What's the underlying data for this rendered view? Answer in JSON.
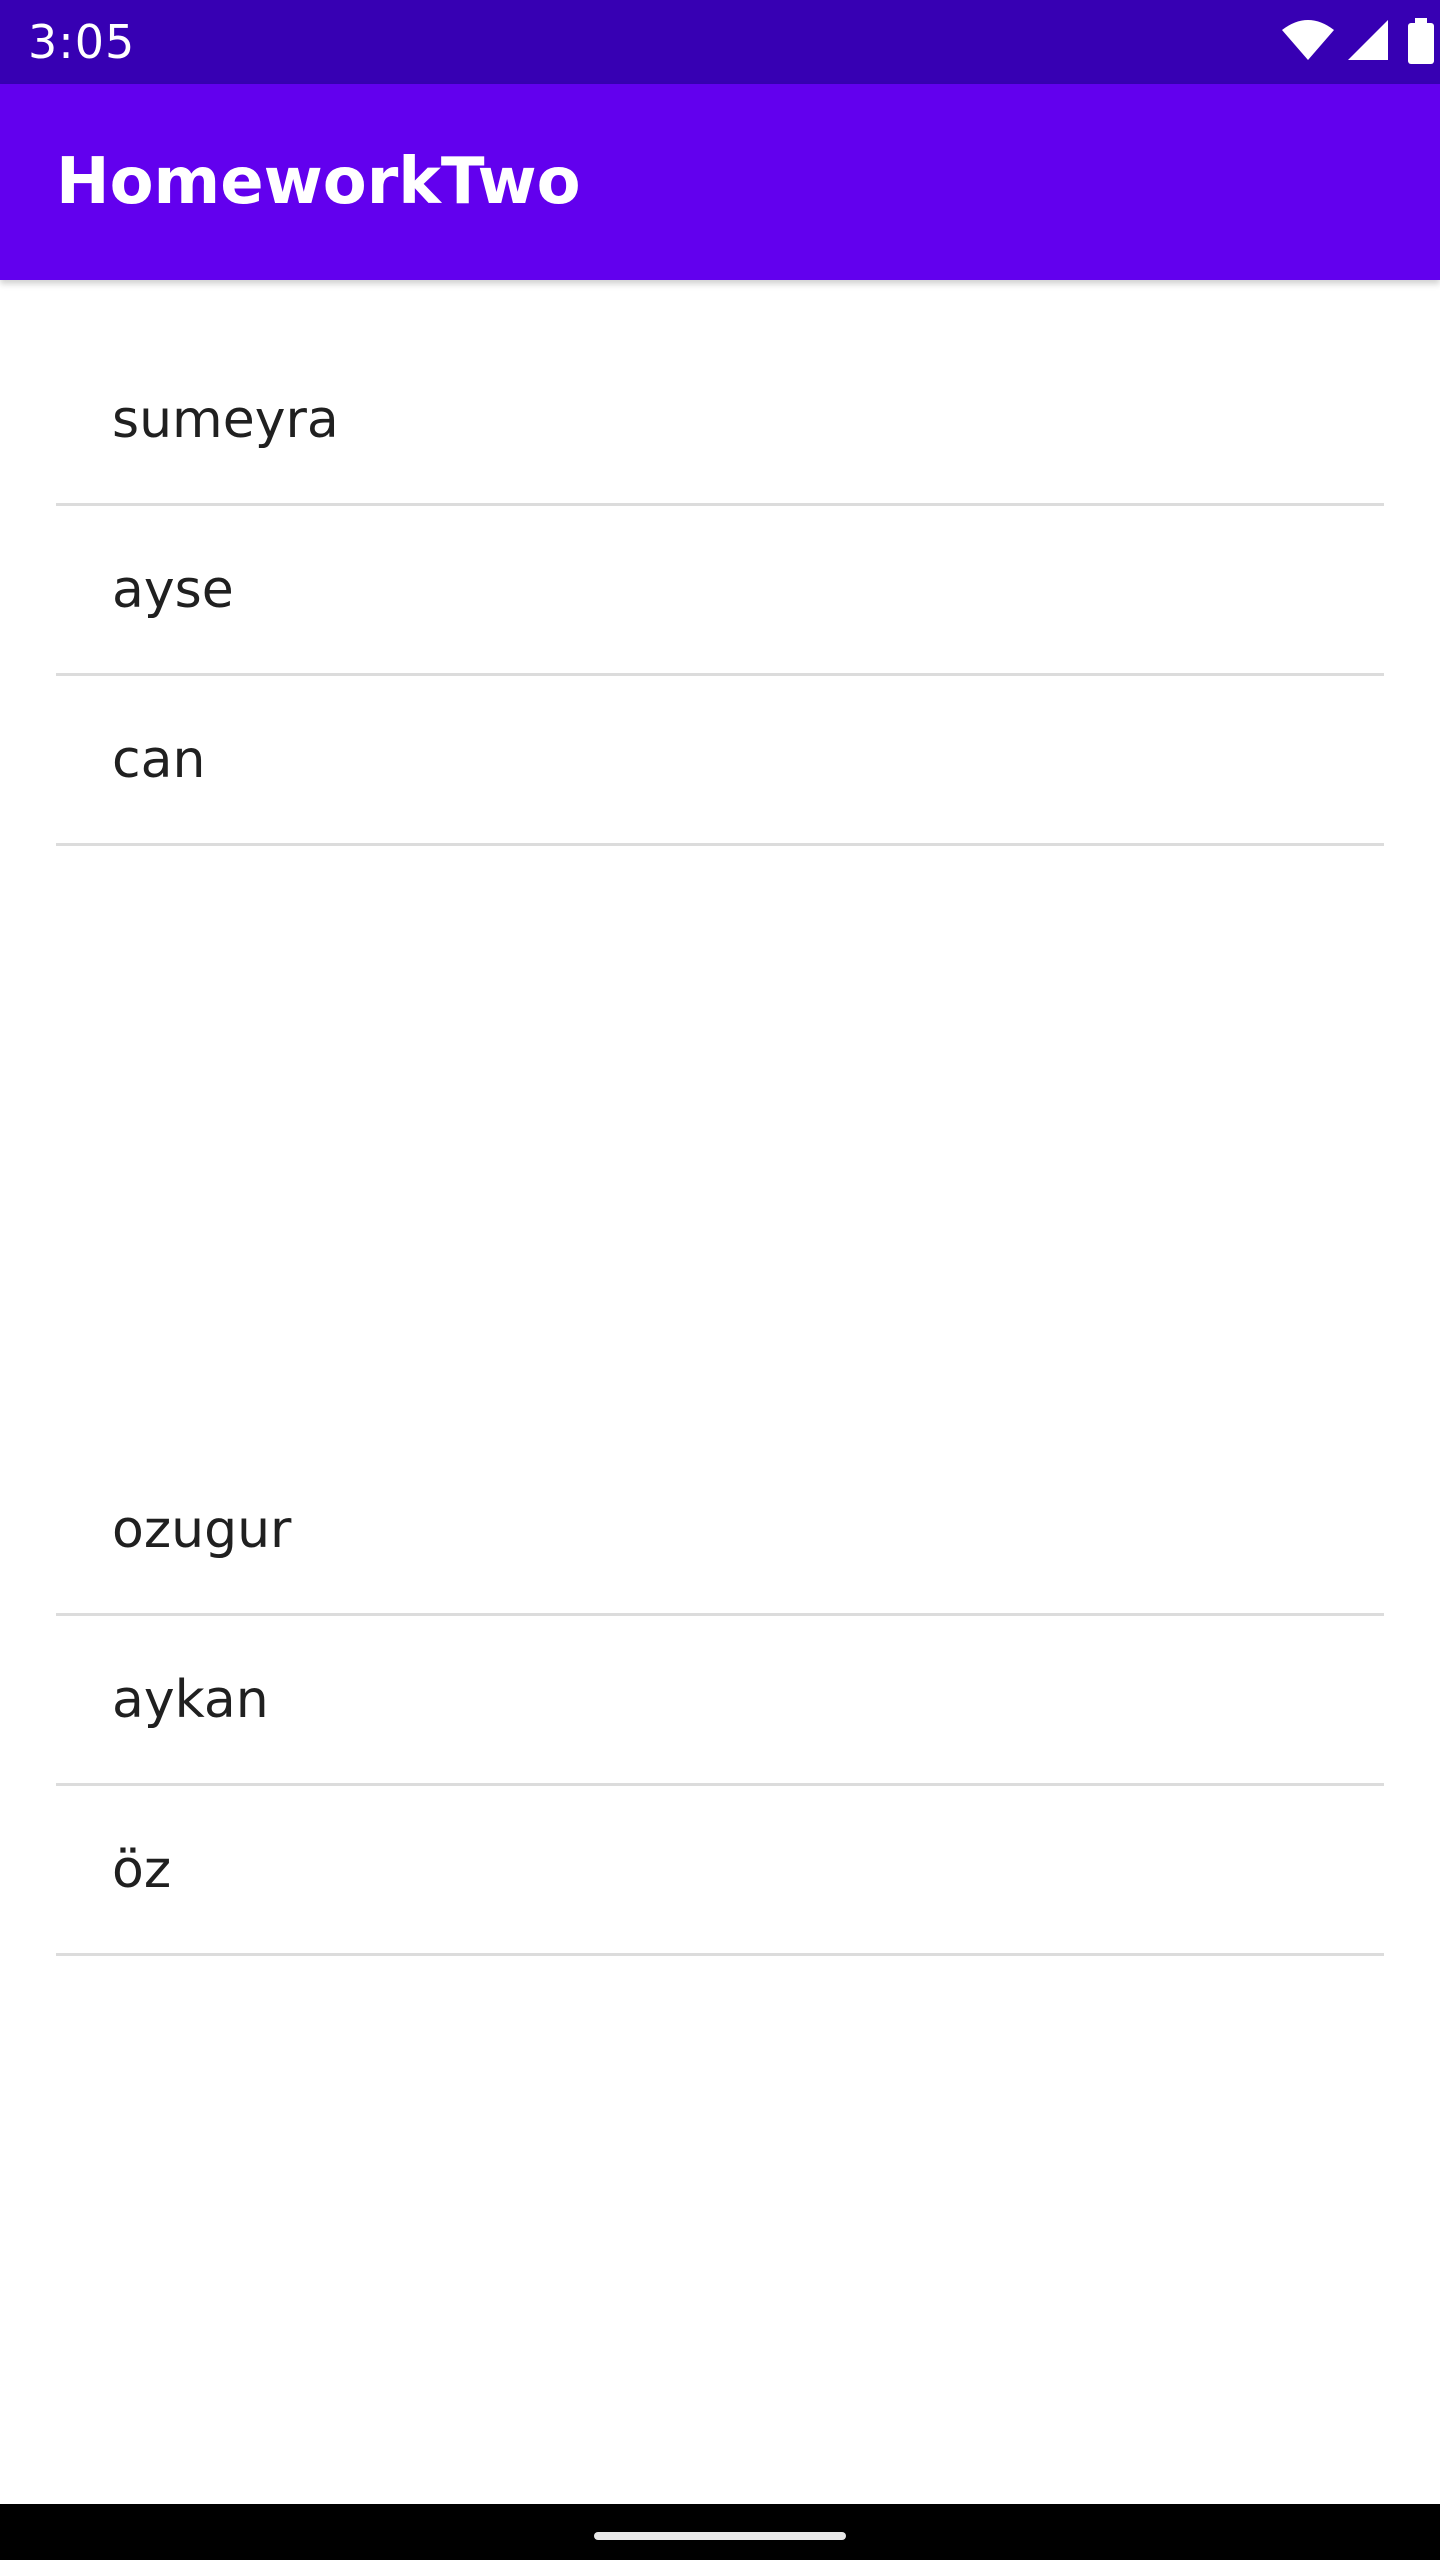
{
  "status_bar": {
    "time": "3:05",
    "icons": [
      "wifi-icon",
      "cell-signal-icon",
      "battery-icon"
    ]
  },
  "app_bar": {
    "title": "HomeworkTwo"
  },
  "list_one": {
    "items": [
      "sumeyra",
      "ayse",
      "can"
    ]
  },
  "list_two": {
    "items": [
      "ozugur",
      "aykan",
      "öz"
    ]
  },
  "colors": {
    "status_bar": "#3700b3",
    "app_bar": "#6200ee",
    "divider": "#dcdcdc",
    "text": "#202020"
  }
}
